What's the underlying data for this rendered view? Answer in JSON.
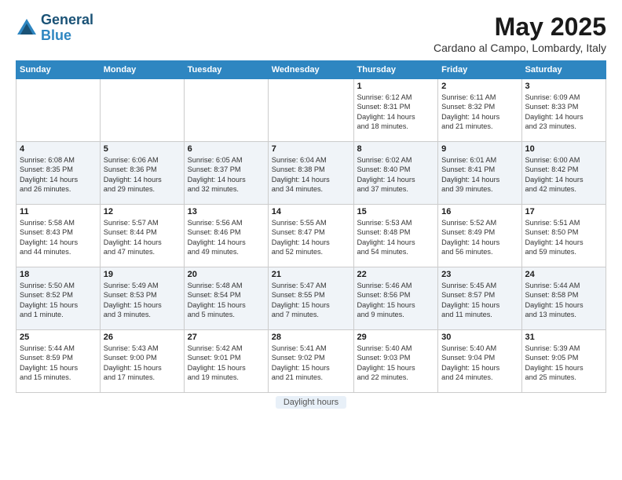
{
  "header": {
    "logo_line1": "General",
    "logo_line2": "Blue",
    "month_title": "May 2025",
    "location": "Cardano al Campo, Lombardy, Italy"
  },
  "footer": {
    "label": "Daylight hours"
  },
  "days_of_week": [
    "Sunday",
    "Monday",
    "Tuesday",
    "Wednesday",
    "Thursday",
    "Friday",
    "Saturday"
  ],
  "weeks": [
    [
      {
        "day": "",
        "info": ""
      },
      {
        "day": "",
        "info": ""
      },
      {
        "day": "",
        "info": ""
      },
      {
        "day": "",
        "info": ""
      },
      {
        "day": "1",
        "info": "Sunrise: 6:12 AM\nSunset: 8:31 PM\nDaylight: 14 hours\nand 18 minutes."
      },
      {
        "day": "2",
        "info": "Sunrise: 6:11 AM\nSunset: 8:32 PM\nDaylight: 14 hours\nand 21 minutes."
      },
      {
        "day": "3",
        "info": "Sunrise: 6:09 AM\nSunset: 8:33 PM\nDaylight: 14 hours\nand 23 minutes."
      }
    ],
    [
      {
        "day": "4",
        "info": "Sunrise: 6:08 AM\nSunset: 8:35 PM\nDaylight: 14 hours\nand 26 minutes."
      },
      {
        "day": "5",
        "info": "Sunrise: 6:06 AM\nSunset: 8:36 PM\nDaylight: 14 hours\nand 29 minutes."
      },
      {
        "day": "6",
        "info": "Sunrise: 6:05 AM\nSunset: 8:37 PM\nDaylight: 14 hours\nand 32 minutes."
      },
      {
        "day": "7",
        "info": "Sunrise: 6:04 AM\nSunset: 8:38 PM\nDaylight: 14 hours\nand 34 minutes."
      },
      {
        "day": "8",
        "info": "Sunrise: 6:02 AM\nSunset: 8:40 PM\nDaylight: 14 hours\nand 37 minutes."
      },
      {
        "day": "9",
        "info": "Sunrise: 6:01 AM\nSunset: 8:41 PM\nDaylight: 14 hours\nand 39 minutes."
      },
      {
        "day": "10",
        "info": "Sunrise: 6:00 AM\nSunset: 8:42 PM\nDaylight: 14 hours\nand 42 minutes."
      }
    ],
    [
      {
        "day": "11",
        "info": "Sunrise: 5:58 AM\nSunset: 8:43 PM\nDaylight: 14 hours\nand 44 minutes."
      },
      {
        "day": "12",
        "info": "Sunrise: 5:57 AM\nSunset: 8:44 PM\nDaylight: 14 hours\nand 47 minutes."
      },
      {
        "day": "13",
        "info": "Sunrise: 5:56 AM\nSunset: 8:46 PM\nDaylight: 14 hours\nand 49 minutes."
      },
      {
        "day": "14",
        "info": "Sunrise: 5:55 AM\nSunset: 8:47 PM\nDaylight: 14 hours\nand 52 minutes."
      },
      {
        "day": "15",
        "info": "Sunrise: 5:53 AM\nSunset: 8:48 PM\nDaylight: 14 hours\nand 54 minutes."
      },
      {
        "day": "16",
        "info": "Sunrise: 5:52 AM\nSunset: 8:49 PM\nDaylight: 14 hours\nand 56 minutes."
      },
      {
        "day": "17",
        "info": "Sunrise: 5:51 AM\nSunset: 8:50 PM\nDaylight: 14 hours\nand 59 minutes."
      }
    ],
    [
      {
        "day": "18",
        "info": "Sunrise: 5:50 AM\nSunset: 8:52 PM\nDaylight: 15 hours\nand 1 minute."
      },
      {
        "day": "19",
        "info": "Sunrise: 5:49 AM\nSunset: 8:53 PM\nDaylight: 15 hours\nand 3 minutes."
      },
      {
        "day": "20",
        "info": "Sunrise: 5:48 AM\nSunset: 8:54 PM\nDaylight: 15 hours\nand 5 minutes."
      },
      {
        "day": "21",
        "info": "Sunrise: 5:47 AM\nSunset: 8:55 PM\nDaylight: 15 hours\nand 7 minutes."
      },
      {
        "day": "22",
        "info": "Sunrise: 5:46 AM\nSunset: 8:56 PM\nDaylight: 15 hours\nand 9 minutes."
      },
      {
        "day": "23",
        "info": "Sunrise: 5:45 AM\nSunset: 8:57 PM\nDaylight: 15 hours\nand 11 minutes."
      },
      {
        "day": "24",
        "info": "Sunrise: 5:44 AM\nSunset: 8:58 PM\nDaylight: 15 hours\nand 13 minutes."
      }
    ],
    [
      {
        "day": "25",
        "info": "Sunrise: 5:44 AM\nSunset: 8:59 PM\nDaylight: 15 hours\nand 15 minutes."
      },
      {
        "day": "26",
        "info": "Sunrise: 5:43 AM\nSunset: 9:00 PM\nDaylight: 15 hours\nand 17 minutes."
      },
      {
        "day": "27",
        "info": "Sunrise: 5:42 AM\nSunset: 9:01 PM\nDaylight: 15 hours\nand 19 minutes."
      },
      {
        "day": "28",
        "info": "Sunrise: 5:41 AM\nSunset: 9:02 PM\nDaylight: 15 hours\nand 21 minutes."
      },
      {
        "day": "29",
        "info": "Sunrise: 5:40 AM\nSunset: 9:03 PM\nDaylight: 15 hours\nand 22 minutes."
      },
      {
        "day": "30",
        "info": "Sunrise: 5:40 AM\nSunset: 9:04 PM\nDaylight: 15 hours\nand 24 minutes."
      },
      {
        "day": "31",
        "info": "Sunrise: 5:39 AM\nSunset: 9:05 PM\nDaylight: 15 hours\nand 25 minutes."
      }
    ]
  ]
}
